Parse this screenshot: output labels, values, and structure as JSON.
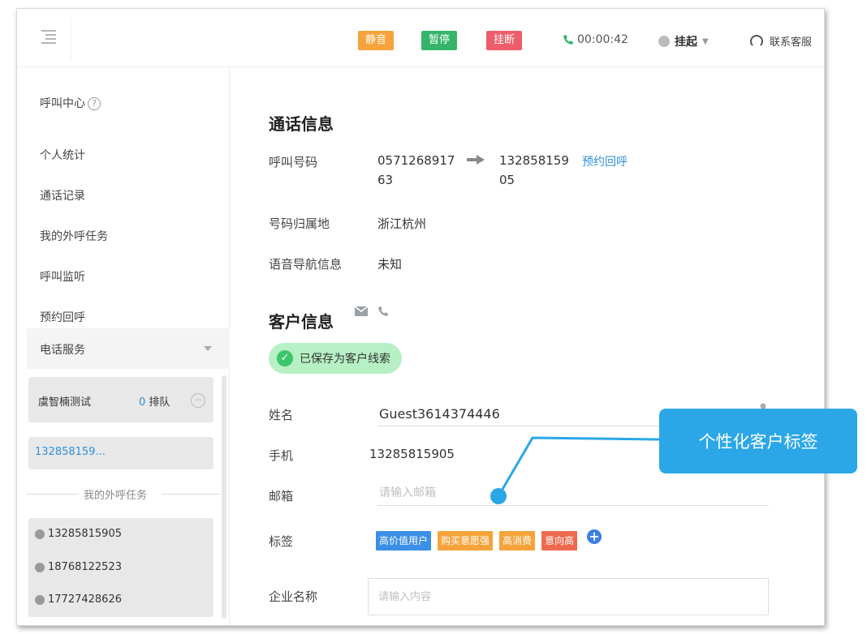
{
  "topbar": {
    "mute_label": "静音",
    "pause_label": "暂停",
    "hangup_label": "挂断",
    "call_timer": "00:00:42",
    "status_label": "挂起",
    "contact_label": "联系客服",
    "colors": {
      "mute": "#f5a33a",
      "pause": "#36b56a",
      "hangup": "#ee5d6a"
    }
  },
  "sidebar": {
    "title": "呼叫中心",
    "items": [
      {
        "label": "个人统计"
      },
      {
        "label": "通话记录"
      },
      {
        "label": "我的外呼任务"
      },
      {
        "label": "呼叫监听"
      },
      {
        "label": "预约回呼"
      }
    ],
    "phone_service_label": "电话服务",
    "queue": {
      "name": "虞智楠测试",
      "count": "0",
      "count_suffix": "排队"
    },
    "active_call": "132858159...",
    "tasks_header": "我的外呼任务",
    "tasks": [
      "13285815905",
      "18768122523",
      "17727428626"
    ]
  },
  "call_info": {
    "title": "通话信息",
    "number_label": "呼叫号码",
    "from_line1": "0571268917",
    "from_line2": "63",
    "to_line1": "132858159",
    "to_line2": "05",
    "callback_link": "预约回呼",
    "location_label": "号码归属地",
    "location_value": "浙江杭州",
    "ivr_label": "语音导航信息",
    "ivr_value": "未知"
  },
  "customer_info": {
    "title": "客户信息",
    "saved_badge": "已保存为客户线索",
    "name_label": "姓名",
    "name_value": "Guest3614374446",
    "mobile_label": "手机",
    "mobile_value": "13285815905",
    "email_label": "邮箱",
    "email_placeholder": "请输入邮箱",
    "tags_label": "标签",
    "tags": [
      {
        "label": "高价值用户",
        "color": "#3b8fe6"
      },
      {
        "label": "购买意愿强",
        "color": "#f5a33a"
      },
      {
        "label": "高消费",
        "color": "#f5a33a"
      },
      {
        "label": "意向高",
        "color": "#ee6a4e"
      }
    ],
    "company_label": "企业名称",
    "company_placeholder": "请输入内容"
  },
  "callout": {
    "text": "个性化客户标签"
  }
}
